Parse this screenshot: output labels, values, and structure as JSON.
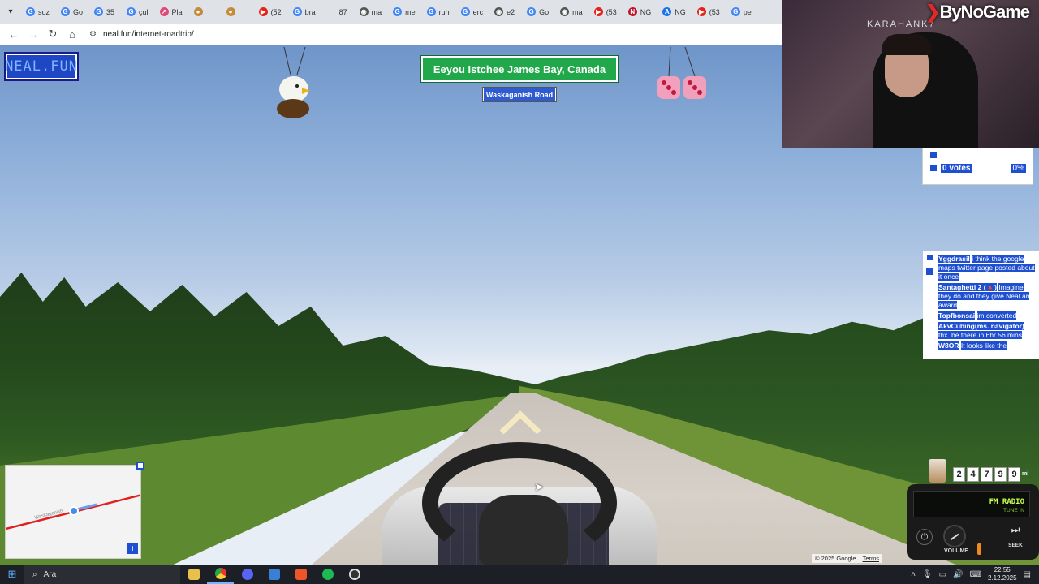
{
  "browser": {
    "tabs": [
      {
        "label": "soz",
        "icon": "google-icon"
      },
      {
        "label": "Go",
        "icon": "google-icon"
      },
      {
        "label": "35",
        "icon": "google-icon"
      },
      {
        "label": "çul",
        "icon": "google-icon"
      },
      {
        "label": "Pla",
        "icon": "link-icon"
      },
      {
        "label": "",
        "icon": "cookie-icon"
      },
      {
        "label": "",
        "icon": "cookie-icon"
      },
      {
        "label": "(52",
        "icon": "youtube-icon"
      },
      {
        "label": "bra",
        "icon": "google-icon"
      },
      {
        "label": "87",
        "icon": "blank-icon"
      },
      {
        "label": "ma",
        "icon": "globe-icon"
      },
      {
        "label": "me",
        "icon": "google-icon"
      },
      {
        "label": "ruh",
        "icon": "google-icon"
      },
      {
        "label": "erc",
        "icon": "google-icon"
      },
      {
        "label": "e2",
        "icon": "globe-icon"
      },
      {
        "label": "Go",
        "icon": "google-icon"
      },
      {
        "label": "ma",
        "icon": "globe-icon"
      },
      {
        "label": "(53",
        "icon": "youtube-icon"
      },
      {
        "label": "NG",
        "icon": "ng-icon"
      },
      {
        "label": "NG",
        "icon": "translate-icon"
      },
      {
        "label": "(53",
        "icon": "youtube-icon"
      },
      {
        "label": "pe",
        "icon": "google-icon"
      }
    ],
    "url": "neal.fun/internet-roadtrip/"
  },
  "game": {
    "logo": "NEAL.FUN",
    "location": "Eeyou Istchee James Bay, Canada",
    "road_name": "Waskaganish Road",
    "odometer": [
      "2",
      "4",
      "7",
      "9",
      "9"
    ],
    "odometer_unit": "mi",
    "radio_title": "FM RADIO",
    "radio_subtitle": "TUNE IN",
    "volume_label": "VOLUME",
    "seek_label": "SEEK",
    "volume_level": 0.5,
    "credits": [
      "© 2025 Google",
      "Terms"
    ],
    "minimap_label": "Waskaganish"
  },
  "poll": {
    "rows": [
      {
        "label": "",
        "percent": ""
      },
      {
        "label": "0 votes",
        "percent": "0%"
      }
    ]
  },
  "chat": [
    {
      "user": "Yggdrasil",
      "text": "i think the google maps twitter page posted about it once"
    },
    {
      "user": "Santaghetti 2 (🔺)",
      "text": "Imagine they do and they give Neal an award"
    },
    {
      "user": "Topfbonsai",
      "text": "im converted"
    },
    {
      "user": "AkvCubing(ms. navigator)",
      "text": "thx. be there in 6hr 56 mins"
    },
    {
      "user": "W8OR",
      "text": "It looks like the"
    }
  ],
  "stream": {
    "brand": "ByNoGame",
    "channel": "KARAHANK7"
  },
  "taskbar": {
    "search_label": "Ara",
    "time": "22:55",
    "date": "2.12.2025"
  },
  "colors": {
    "location_bg": "#20a84a",
    "highlight_blue": "#1e4fd1",
    "radio_text": "#c6ff4a"
  }
}
